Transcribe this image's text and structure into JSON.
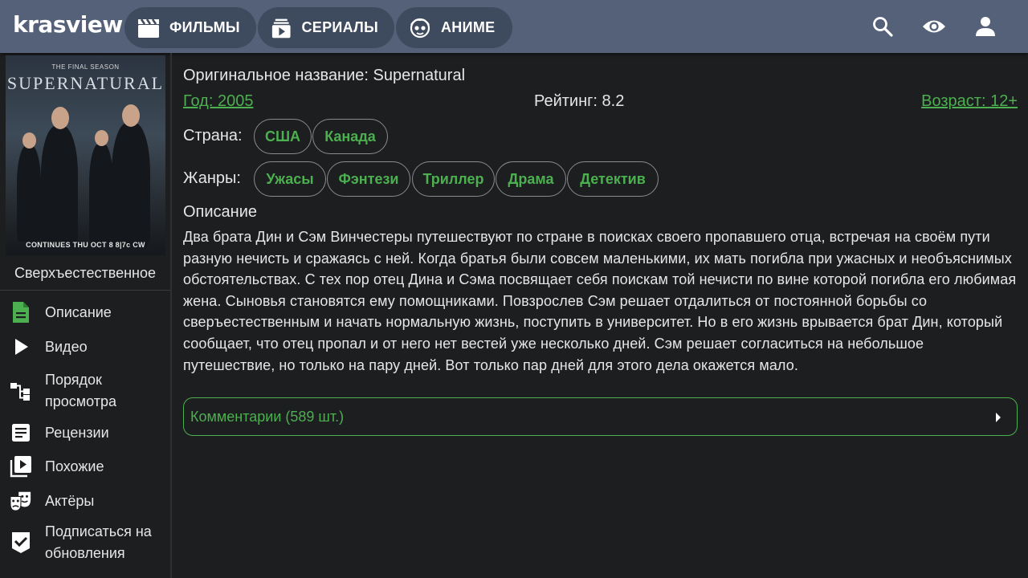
{
  "header": {
    "logo": "krasview",
    "nav": [
      {
        "label": "ФИЛЬМЫ",
        "icon": "clapperboard-icon"
      },
      {
        "label": "СЕРИАЛЫ",
        "icon": "tv-series-icon"
      },
      {
        "label": "АНИМЕ",
        "icon": "anime-face-icon"
      }
    ],
    "actions": [
      "search-icon",
      "eye-icon",
      "user-icon"
    ]
  },
  "sidebar": {
    "poster": {
      "top_text": "THE FINAL SEASON",
      "title": "SUPERNATURAL",
      "bottom_text": "CONTINUES THU OCT 8  8|7c  CW"
    },
    "title": "Сверхъестественное",
    "menu": [
      {
        "label": "Описание",
        "icon": "document-icon",
        "active": true
      },
      {
        "label": "Видео",
        "icon": "play-icon"
      },
      {
        "label": "Порядок просмотра",
        "icon": "hierarchy-icon"
      },
      {
        "label": "Рецензии",
        "icon": "review-icon"
      },
      {
        "label": "Похожие",
        "icon": "video-library-icon"
      },
      {
        "label": "Актёры",
        "icon": "theater-masks-icon"
      },
      {
        "label": "Подписаться на обновления",
        "icon": "subscribe-check-icon"
      }
    ]
  },
  "main": {
    "original_title": "Оригинальное название: Supernatural",
    "year": "Год: 2005",
    "rating": "Рейтинг: 8.2",
    "age": "Возраст: 12+",
    "country_label": "Страна:",
    "countries": [
      "США",
      "Канада"
    ],
    "genres_label": "Жанры:",
    "genres": [
      "Ужасы",
      "Фэнтези",
      "Триллер",
      "Драма",
      "Детектив"
    ],
    "description_heading": "Описание",
    "description": "Два брата Дин и Сэм Винчестеры путешествуют по стране в поисках своего пропавшего отца, встречая на своём пути разную нечисть и сражаясь с ней. Когда братья были совсем маленькими, их мать погибла при ужасных и необъяснимых обстоятельствах. С тех пор отец Дина и Сэма посвящает себя поискам той нечисти по вине которой погибла его любимая жена. Сыновья становятся ему помощниками. Повзрослев Сэм решает отдалиться от постоянной борьбы со сверъестественным и начать нормальную жизнь, поступить в университет. Но в его жизнь врывается брат Дин, который сообщает, что отец пропал и от него нет вестей уже несколько дней. Сэм решает согласиться на небольшое путешествие, но только на пару дней. Вот только пар дней для этого дела окажется мало.",
    "comments": "Комментарии (589 шт.)"
  },
  "colors": {
    "header_bg": "#556179",
    "nav_btn_bg": "#3e4a5e",
    "page_bg": "#1d1e20",
    "accent_green": "#4caf50"
  }
}
